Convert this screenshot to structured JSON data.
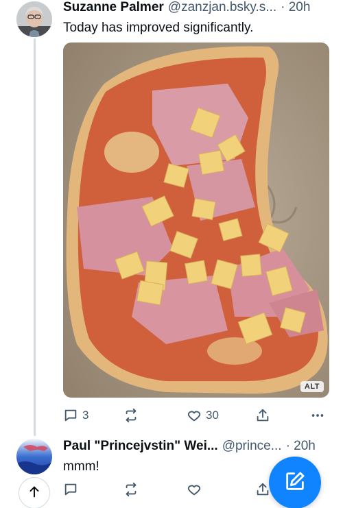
{
  "thread": {
    "root_post": {
      "author_name": "Suzanne Palmer",
      "handle": "@zanzjan.bsky.s...",
      "time": "· 20h",
      "text": "Today has improved significantly.",
      "media_alt_badge": "ALT",
      "media_subject": "half-eaten ham and pineapple pizza in box",
      "reply_count": "3",
      "repost_count": "",
      "like_count": "30"
    },
    "reply_post": {
      "author_name": "Paul \"Princejvstin\" Wei...",
      "handle": "@prince...",
      "time": "· 20h",
      "text": "mmm!",
      "reply_count": "",
      "repost_count": "",
      "like_count": ""
    }
  },
  "icons": {
    "reply": "speech-bubble-icon",
    "repost": "repost-icon",
    "like": "heart-icon",
    "share": "share-icon",
    "more": "more-dots-icon",
    "scroll_up": "arrow-up-icon",
    "compose": "compose-icon"
  },
  "colors": {
    "accent": "#1083fe",
    "thread_line": "#d4dbe2",
    "secondary_text": "#42576c"
  }
}
